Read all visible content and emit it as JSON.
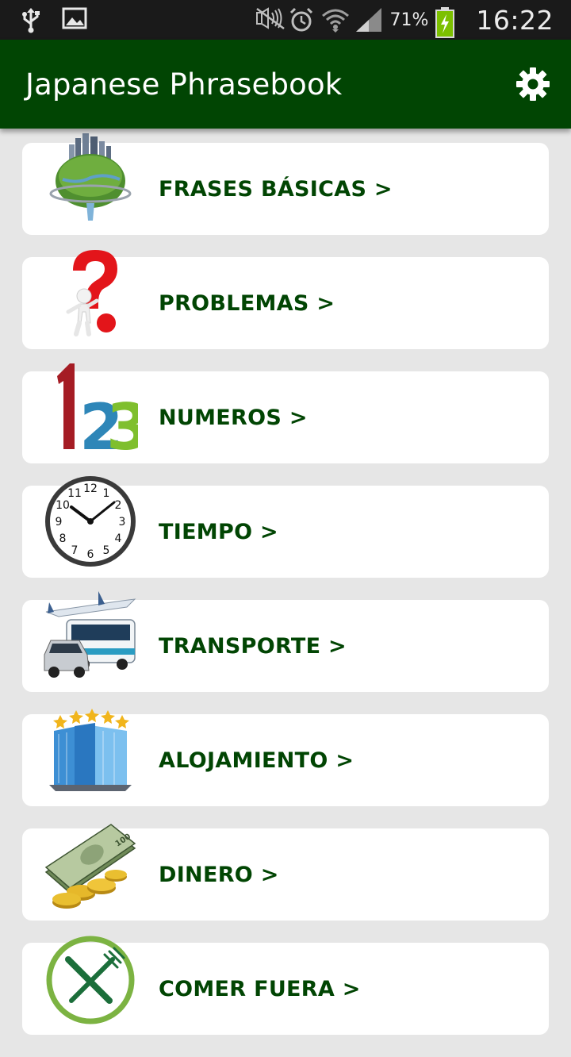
{
  "status_bar": {
    "battery_percent": "71%",
    "clock": "16:22",
    "icons": [
      "usb-icon",
      "image-icon",
      "mute-icon",
      "alarm-icon",
      "wifi-icon",
      "signal-icon",
      "battery-charging-icon"
    ]
  },
  "app_bar": {
    "title": "Japanese Phrasebook",
    "settings_icon": "gear-icon"
  },
  "colors": {
    "app_bar": "#014503",
    "label": "#014503",
    "background": "#e6e6e6",
    "card": "#ffffff",
    "status_bar": "#1a1a1a"
  },
  "categories": [
    {
      "label": "FRASES BÁSICAS >",
      "icon": "globe-city-icon"
    },
    {
      "label": "PROBLEMAS >",
      "icon": "question-mark-figure-icon"
    },
    {
      "label": "NUMEROS >",
      "icon": "numbers-123-icon"
    },
    {
      "label": "TIEMPO >",
      "icon": "clock-icon"
    },
    {
      "label": "TRANSPORTE >",
      "icon": "transport-icon"
    },
    {
      "label": "ALOJAMIENTO >",
      "icon": "hotel-building-icon"
    },
    {
      "label": "DINERO >",
      "icon": "money-icon"
    },
    {
      "label": "COMER FUERA >",
      "icon": "fork-knife-icon"
    }
  ]
}
